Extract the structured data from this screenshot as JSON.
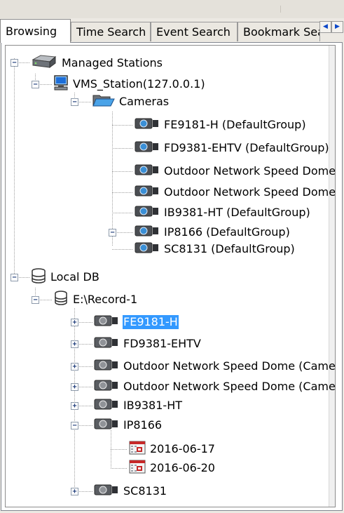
{
  "tabs": {
    "items": [
      "Browsing",
      "Time Search",
      "Event Search",
      "Bookmark Search"
    ],
    "active": "Browsing",
    "scroll_left": "◀",
    "scroll_right": "▶"
  },
  "tree": {
    "managed": {
      "label": "Managed Stations",
      "station": {
        "label": "VMS_Station(127.0.0.1)",
        "folder": {
          "label": "Cameras",
          "cameras": [
            "FE9181-H (DefaultGroup)",
            "FD9381-EHTV (DefaultGroup)",
            "Outdoor Network Speed Dome (DefaultGroup)",
            "Outdoor Network Speed Dome (DefaultGroup)",
            "IB9381-HT (DefaultGroup)",
            "IP8166 (DefaultGroup)",
            "SC8131 (DefaultGroup)"
          ]
        }
      }
    },
    "local": {
      "label": "Local DB",
      "drive": {
        "label": "E:\\Record-1",
        "cameras": [
          "FE9181-H",
          "FD9381-EHTV",
          "Outdoor Network Speed Dome (Camera)",
          "Outdoor Network Speed Dome (Camera)",
          "IB9381-HT",
          "IP8166",
          "SC8131"
        ],
        "dates": [
          "2016-06-17",
          "2016-06-20"
        ],
        "selected": "FE9181-H"
      }
    }
  },
  "toggles": {
    "expanded": "−",
    "collapsed": "+"
  },
  "colors": {
    "selection": "#3399ff",
    "camera_blue": "#3a8fd6",
    "calendar_red": "#c62828"
  }
}
